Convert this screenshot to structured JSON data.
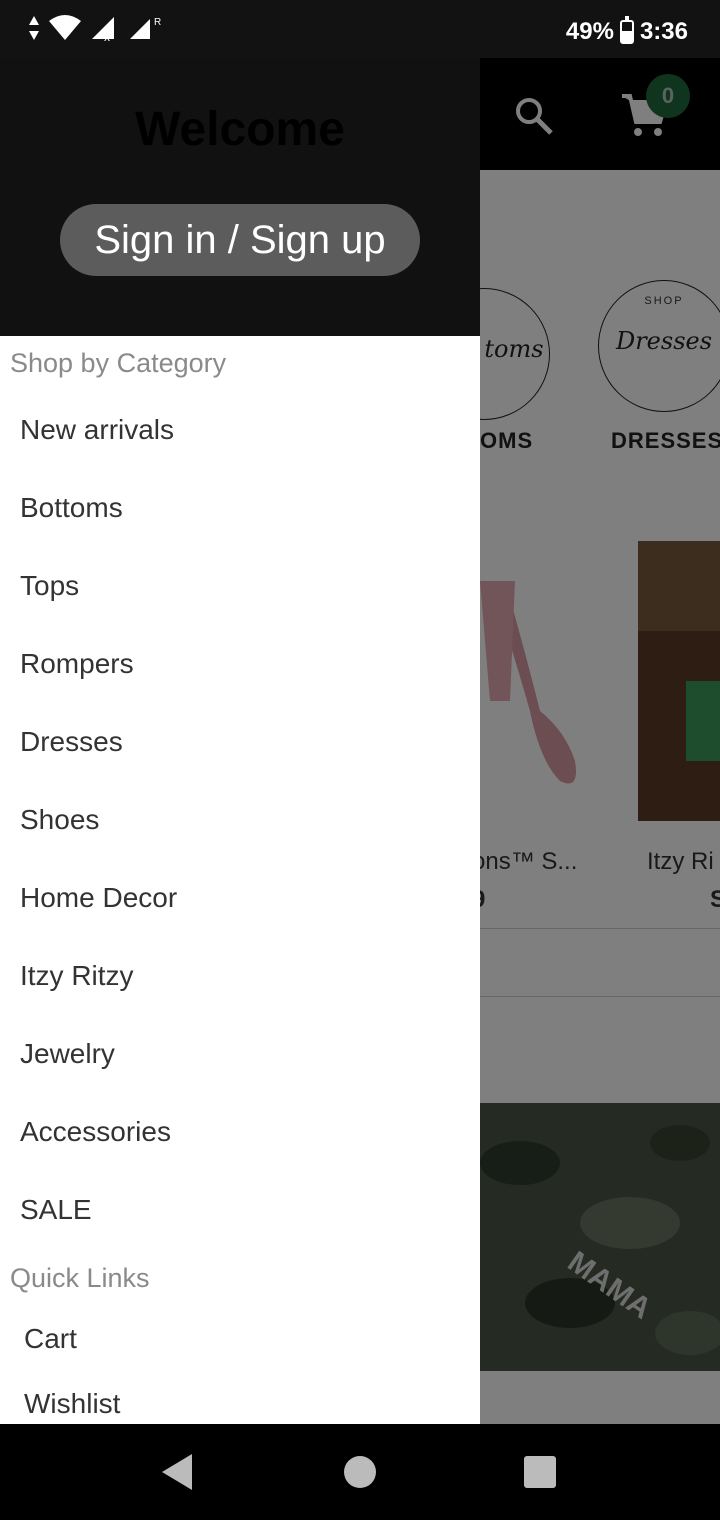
{
  "status_bar": {
    "battery": "49%",
    "time": "3:36"
  },
  "app": {
    "cart_count": "0",
    "categories": [
      {
        "label": "OMS",
        "script": "toms"
      },
      {
        "label": "DRESSES",
        "shop": "SHOP",
        "script": "Dresses"
      }
    ],
    "products": [
      {
        "title": "ons™ S...",
        "price": "9"
      },
      {
        "title": "Itzy Ri",
        "price": "S"
      }
    ]
  },
  "drawer": {
    "welcome": "Welcome",
    "signin_label": "Sign in / Sign up",
    "shop_by_category_label": "Shop by Category",
    "categories": [
      "New arrivals",
      "Bottoms",
      "Tops",
      "Rompers",
      "Dresses",
      "Shoes",
      "Home Decor",
      "Itzy Ritzy",
      "Jewelry",
      "Accessories",
      "SALE"
    ],
    "quick_links_label": "Quick Links",
    "quick_links": [
      "Cart",
      "Wishlist"
    ]
  },
  "icons": {
    "search": "search-icon",
    "cart": "cart-icon",
    "back": "back-icon",
    "home": "home-icon",
    "recents": "recents-icon"
  }
}
